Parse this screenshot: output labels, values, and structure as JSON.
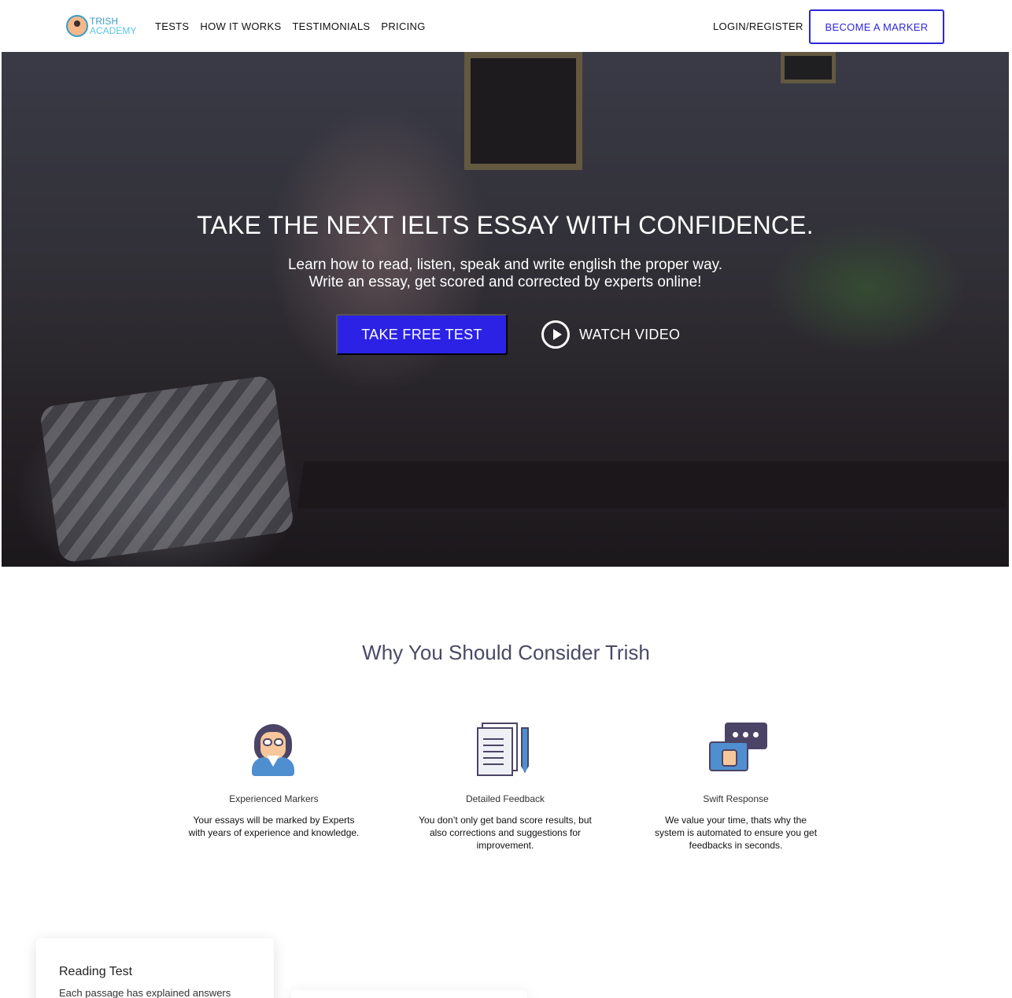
{
  "nav": {
    "logo_line1": "TRISH",
    "logo_line2": "ACADEMY",
    "links": [
      "TESTS",
      "HOW IT WORKS",
      "TESTIMONIALS",
      "PRICING"
    ],
    "login": "LOGIN/REGISTER",
    "marker_button": "BECOME A MARKER"
  },
  "hero": {
    "title": "TAKE THE NEXT IELTS ESSAY WITH CONFIDENCE.",
    "subtitle_line1": "Learn how to read, listen, speak and write english the proper way.",
    "subtitle_line2": "Write an essay, get scored and corrected by experts online!",
    "cta": "TAKE FREE TEST",
    "watch": "WATCH VIDEO"
  },
  "why": {
    "title": "Why You Should Consider Trish",
    "features": [
      {
        "icon": "teacher-icon",
        "title": "Experienced Markers",
        "desc": "Your essays will be marked by Experts with years of experience and knowledge."
      },
      {
        "icon": "document-checklist-icon",
        "title": "Detailed Feedback",
        "desc": "You don’t only get band score results, but also corrections and suggestions for improvement."
      },
      {
        "icon": "chat-thumbs-up-icon",
        "title": "Swift Response",
        "desc": "We value your time, thats why the system is automated to ensure you get feedbacks in seconds."
      }
    ]
  },
  "cards": [
    {
      "title": "Reading Test",
      "desc": "Each passage has explained answers"
    }
  ],
  "colors": {
    "primary": "#2b22e6",
    "heading": "#4a4a66",
    "logo": "#3a9cc8"
  }
}
